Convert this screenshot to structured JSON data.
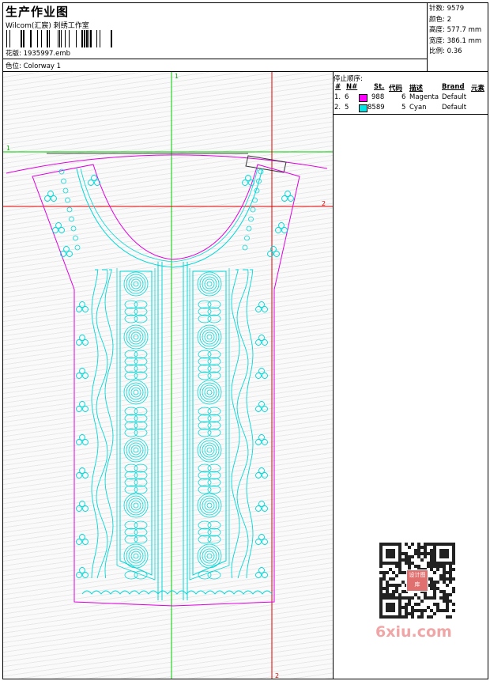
{
  "header": {
    "title": "生产作业图",
    "subtitle": "Wilcom(汇宸) 刺绣工作室",
    "design_label": "花版:",
    "design_value": "1935997.emb",
    "colorway_label": "色位:",
    "colorway_value": "Colorway 1"
  },
  "stats": {
    "stitches_label": "针数:",
    "stitches_value": "9579",
    "colors_label": "颜色:",
    "colors_value": "2",
    "height_label": "高度:",
    "height_value": "577.7 mm",
    "width_label": "宽度:",
    "width_value": "386.1 mm",
    "scale_label": "比例:",
    "scale_value": "0.36"
  },
  "stop_sequence": {
    "title": "停止顺序:",
    "headers": {
      "num": "#",
      "n": "N#",
      "st": "St.",
      "code": "代码",
      "desc": "描述",
      "brand": "Brand",
      "elem": "元素"
    },
    "rows": [
      {
        "num": "1.",
        "n": "6",
        "swatch": "#ff00ff",
        "st": "988",
        "code": "6",
        "desc": "Magenta",
        "brand": "Default"
      },
      {
        "num": "2.",
        "n": "5",
        "swatch": "#00e5e5",
        "st": "8589",
        "code": "5",
        "desc": "Cyan",
        "brand": "Default"
      }
    ]
  },
  "guides": {
    "vertical_1": "1",
    "horizontal_1": "1",
    "horizontal_2": "2",
    "vertical_2": "2"
  },
  "colors": {
    "magenta": "#e000e0",
    "cyan": "#00d8d8",
    "green_guide": "#00cc00",
    "red_guide": "#e00000"
  },
  "watermark": {
    "text": "6xiu.com",
    "stamp": "设计图库"
  }
}
